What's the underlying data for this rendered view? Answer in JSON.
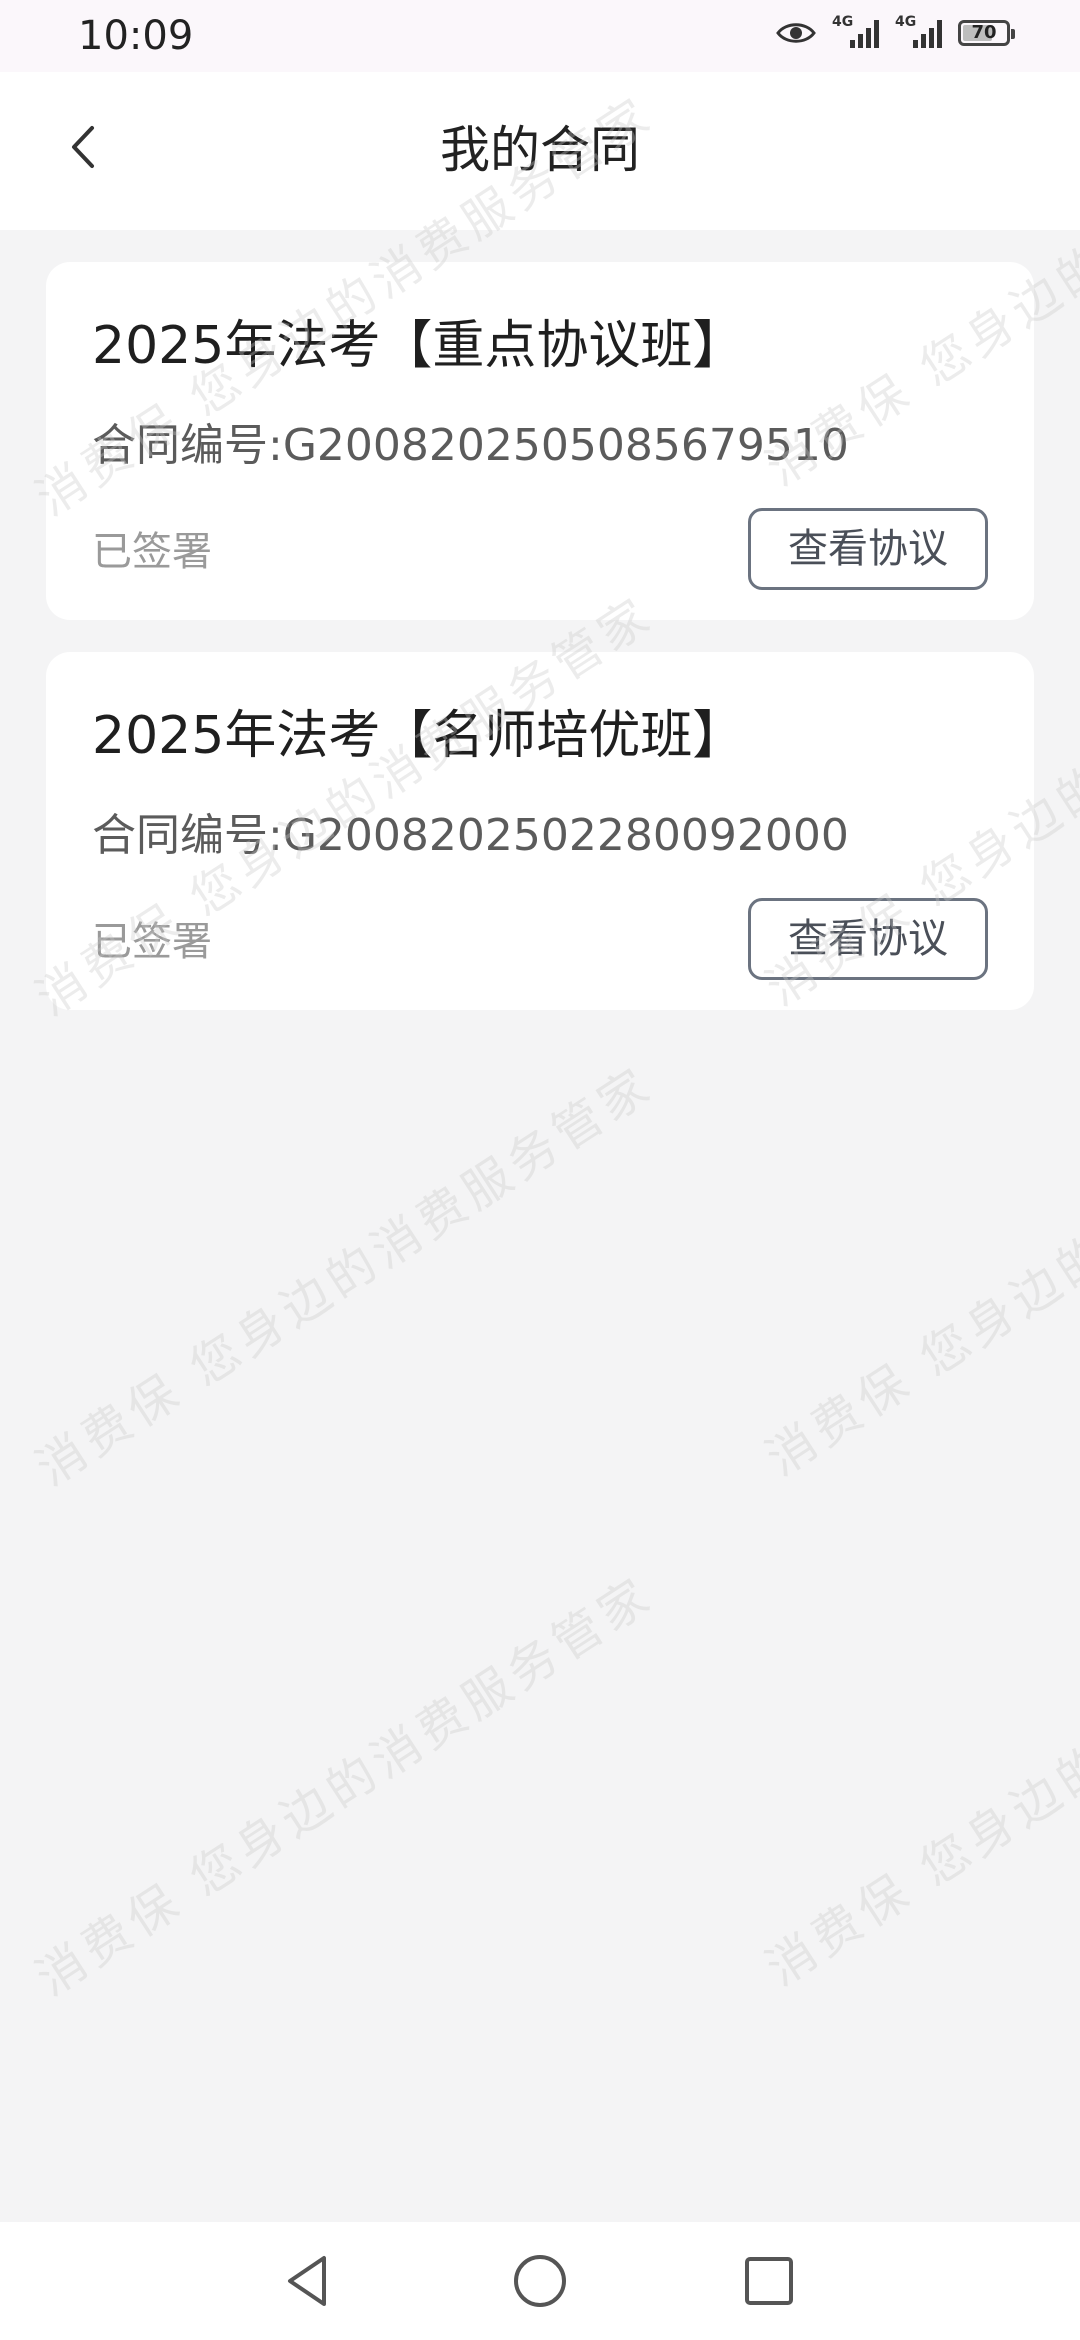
{
  "status_bar": {
    "time": "10:09",
    "network_1": "4G",
    "network_2": "4G",
    "battery_level": "70",
    "battery_fraction": 0.7
  },
  "header": {
    "title": "我的合同",
    "back_icon": "chevron-left-icon"
  },
  "contracts": [
    {
      "title": "2025年法考【重点协议班】",
      "contract_no": "合同编号:G2008202505085679510",
      "status": "已签署",
      "action": "查看协议"
    },
    {
      "title": "2025年法考【名师培优班】",
      "contract_no": "合同编号:G2008202502280092000",
      "status": "已签署",
      "action": "查看协议"
    }
  ],
  "watermark": {
    "text": "消费保 您身边的消费服务管家"
  },
  "nav_bar": {
    "back_icon": "triangle-back-icon",
    "home_icon": "circle-home-icon",
    "recent_icon": "square-recent-icon"
  },
  "colors": {
    "background": "#f4f4f5",
    "card": "#ffffff",
    "button_border": "#6b7380",
    "status_text": "#9a9a9a"
  }
}
